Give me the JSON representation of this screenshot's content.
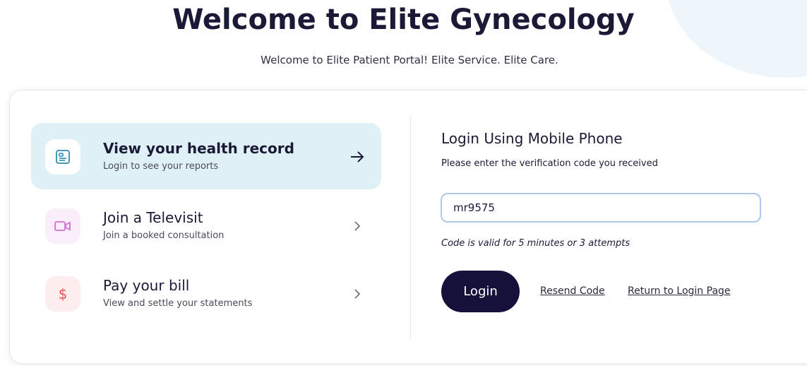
{
  "header": {
    "title": "Welcome to Elite Gynecology",
    "subtitle": "Welcome to Elite Patient Portal! Elite Service. Elite Care."
  },
  "options": [
    {
      "title": "View your health record",
      "description": "Login to see your reports",
      "icon": "health-record-icon",
      "arrow": "arrow-right-icon",
      "active": true
    },
    {
      "title": "Join a Televisit",
      "description": "Join a booked consultation",
      "icon": "video-camera-icon",
      "arrow": "chevron-right-icon",
      "active": false
    },
    {
      "title": "Pay your bill",
      "description": "View and settle your statements",
      "icon": "dollar-icon",
      "arrow": "chevron-right-icon",
      "active": false
    }
  ],
  "login": {
    "title": "Login Using Mobile Phone",
    "instruction": "Please enter the verification code you received",
    "code_value": "mr9575",
    "validity_note": "Code is valid for 5 minutes or 3 attempts",
    "login_label": "Login",
    "resend_label": "Resend Code",
    "return_label": "Return to Login Page"
  },
  "colors": {
    "primary_dark": "#15113a",
    "active_option_bg": "#dff1f7",
    "input_border": "#aec9e8",
    "televisit_icon": "#d36fd6",
    "bill_icon": "#e8505b"
  }
}
